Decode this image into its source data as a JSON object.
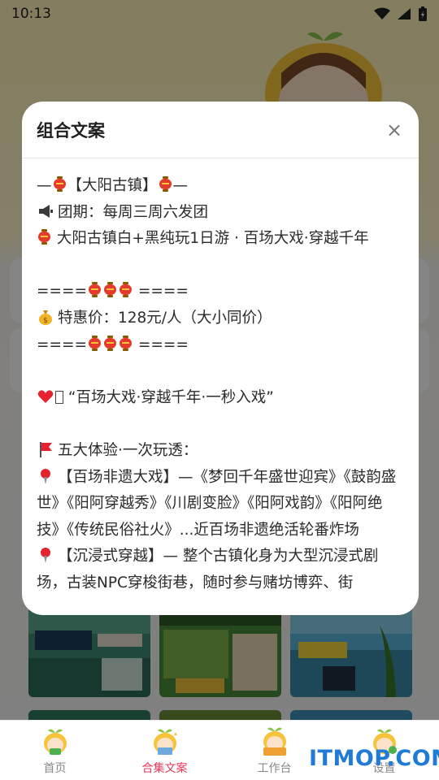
{
  "status_bar": {
    "time": "10:13"
  },
  "dialog": {
    "title": "组合文案",
    "close_glyph": "×",
    "lines": {
      "l1_a": "—",
      "l1_b": "【大阳古镇】",
      "l1_c": "—",
      "l2": "团期：每周三周六发团",
      "l3": "大阳古镇白+黑纯玩1日游 · 百场大戏·穿越千年",
      "l5_a": "====",
      "l5_b": "====",
      "l6": "特惠价：128元/人（大小同价）",
      "l7_a": "====",
      "l7_b": "====",
      "l9": "“百场大戏·穿越千年·一秒入戏”",
      "l11": "五大体验·一次玩透：",
      "l12": "【百场非遗大戏】—《梦回千年盛世迎宾》《鼓韵盛世》《阳阿穿越秀》《川剧变脸》《阳阿戏韵》《阳阿绝技》《传统民俗社火》...近百场非遗绝活轮番炸场",
      "l13": "【沉浸式穿越】— 整个古镇化身为大型沉浸式剧场，古装NPC穿梭街巷，随时参与赌坊博弈、街"
    }
  },
  "tabs": [
    {
      "label": "首页"
    },
    {
      "label": "合集文案"
    },
    {
      "label": "工作台"
    },
    {
      "label": "设置"
    }
  ],
  "watermark": "ITMOP.COM",
  "colors": {
    "active_tab": "#e43b5a",
    "watermark": "#1f7bd6",
    "lantern": "#e53a2a"
  }
}
